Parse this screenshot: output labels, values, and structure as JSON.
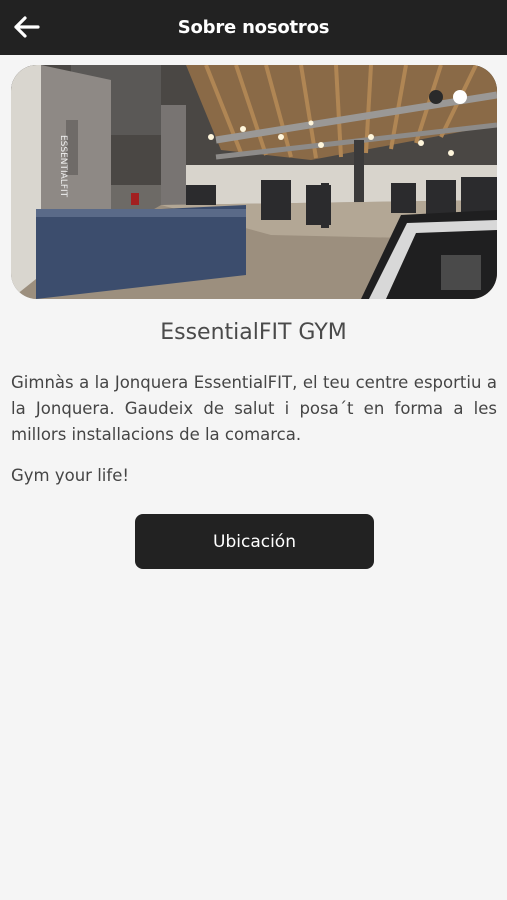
{
  "header": {
    "title": "Sobre nosotros",
    "back_icon": "arrow-left-icon"
  },
  "carousel": {
    "slide_count": 2,
    "active_index": 1,
    "image_signage": "ESSENTIALFIT"
  },
  "content": {
    "title": "EssentialFIT GYM",
    "description": "Gimnàs a la Jonquera EssentialFIT, el teu centre esportiu a la Jonquera. Gaudeix de salut i posa´t en forma a les millors installacions de la comarca.",
    "slogan": "Gym your life!"
  },
  "actions": {
    "location_label": "Ubicación"
  },
  "colors": {
    "header_bg": "#222222",
    "page_bg": "#f5f5f5",
    "button_bg": "#222222"
  }
}
